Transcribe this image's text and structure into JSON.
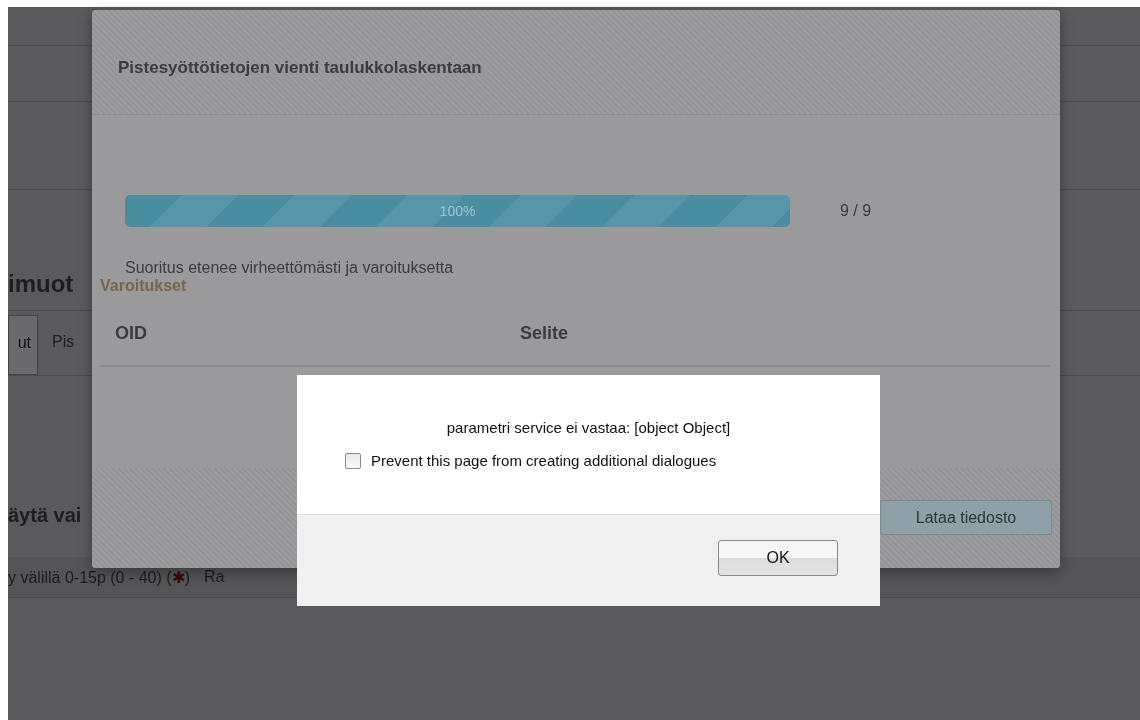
{
  "background_page": {
    "heading": "imuot",
    "tabs": [
      {
        "label": "ut",
        "selected": true
      },
      {
        "label": "Pis",
        "selected": false
      }
    ],
    "section_heading": "äytä vai",
    "row_text_before": "y välillä 0-15p (0 - 40) (",
    "required_mark": "✱",
    "row_text_after": ")",
    "row_next": "Ra"
  },
  "export_dialog": {
    "title": "Pistesyöttötietojen vienti taulukkolaskentaan",
    "progress": {
      "level": 1,
      "label": "100%",
      "count": "9 / 9"
    },
    "status": "Suoritus etenee virheettömästi ja varoituksetta",
    "warnings_title": "Varoitukset",
    "columns": [
      "OID",
      "Selite"
    ],
    "button": "Lataa tiedosto"
  },
  "alert": {
    "message": "parametri service ei vastaa: [object Object]",
    "checkbox": {
      "label": "Prevent this page from creating additional dialogues",
      "checked": false
    },
    "button": "OK"
  }
}
